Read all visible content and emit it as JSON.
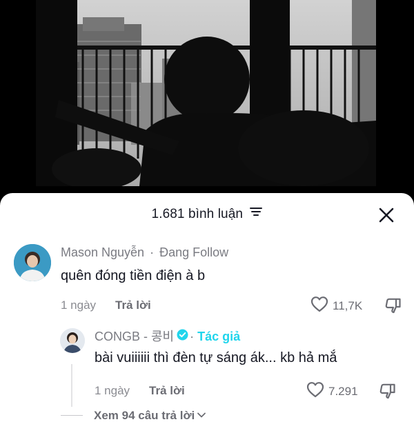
{
  "sheet": {
    "count": "1.681",
    "label": "bình luận",
    "filter_icon": "filter-lines-icon",
    "close_icon": "close-icon"
  },
  "comment": {
    "author": "Mason Nguyễn",
    "separator": "·",
    "follow_status": "Đang Follow",
    "text": "quên đóng tiền điện à b",
    "time": "1 ngày",
    "reply_label": "Trả lời",
    "likes": "11,7K"
  },
  "reply": {
    "author": "CONGB - 콩비",
    "separator": "·",
    "author_tag": "Tác giả",
    "text": "bài vuiiiiii thì đèn tự sáng ák... kb hả mắ",
    "time": "1 ngày",
    "reply_label": "Trả lời",
    "likes": "7.291"
  },
  "view_more": {
    "label": "Xem 94 câu trả lời"
  },
  "colors": {
    "accent": "#20d5ec",
    "verified": "#20d5ec",
    "text_primary": "#161823",
    "text_secondary": "#7a7b82"
  }
}
